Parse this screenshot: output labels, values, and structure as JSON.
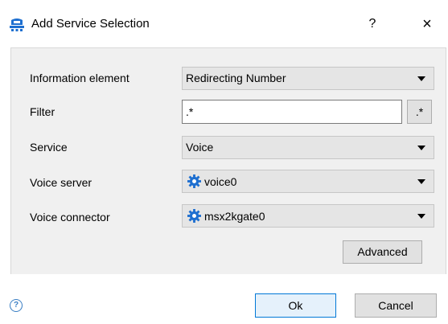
{
  "window": {
    "title": "Add Service Selection",
    "help_label": "?",
    "close_label": "×"
  },
  "form": {
    "information_element": {
      "label": "Information element",
      "value": "Redirecting Number"
    },
    "filter": {
      "label": "Filter",
      "value": ".*",
      "regex_button": ".*"
    },
    "service": {
      "label": "Service",
      "value": "Voice"
    },
    "voice_server": {
      "label": "Voice server",
      "value": "voice0",
      "icon": "gear-icon"
    },
    "voice_connector": {
      "label": "Voice connector",
      "value": "msx2kgate0",
      "icon": "gear-icon"
    },
    "advanced_label": "Advanced"
  },
  "footer": {
    "help_icon": "help-circle-icon",
    "help_glyph": "?",
    "ok_label": "Ok",
    "cancel_label": "Cancel"
  },
  "colors": {
    "accent": "#0078d7",
    "icon_blue": "#1e6fd0",
    "content_bg": "#f0f0f0"
  }
}
